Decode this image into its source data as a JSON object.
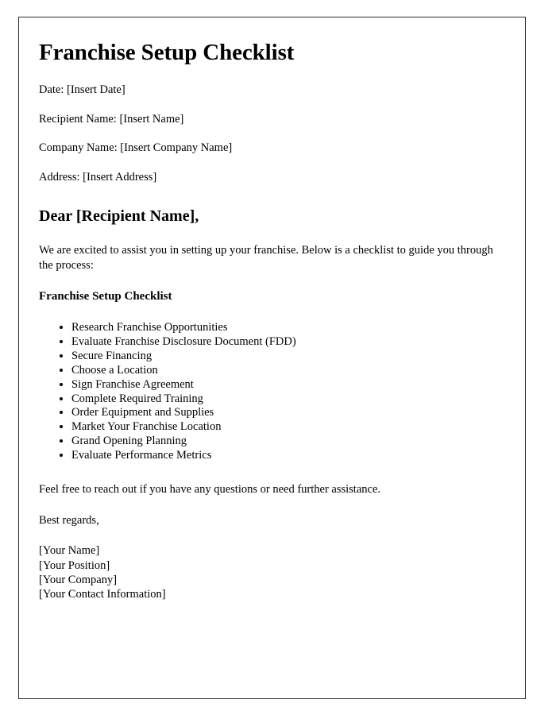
{
  "document": {
    "title": "Franchise Setup Checklist",
    "meta_fields": [
      "Date: [Insert Date]",
      "Recipient Name: [Insert Name]",
      "Company Name: [Insert Company Name]",
      "Address: [Insert Address]"
    ],
    "salutation": "Dear [Recipient Name],",
    "intro_paragraph": "We are excited to assist you in setting up your franchise. Below is a checklist to guide you through the process:",
    "section_heading": "Franchise Setup Checklist",
    "checklist_items": [
      "Research Franchise Opportunities",
      "Evaluate Franchise Disclosure Document (FDD)",
      "Secure Financing",
      "Choose a Location",
      "Sign Franchise Agreement",
      "Complete Required Training",
      "Order Equipment and Supplies",
      "Market Your Franchise Location",
      "Grand Opening Planning",
      "Evaluate Performance Metrics"
    ],
    "closing_paragraph": "Feel free to reach out if you have any questions or need further assistance.",
    "signoff": "Best regards,",
    "signature_lines": [
      "[Your Name]",
      "[Your Position]",
      "[Your Company]",
      "[Your Contact Information]"
    ]
  },
  "colors": {
    "text": "#000000",
    "page_background": "#ffffff",
    "page_border": "#2b2b2b"
  }
}
